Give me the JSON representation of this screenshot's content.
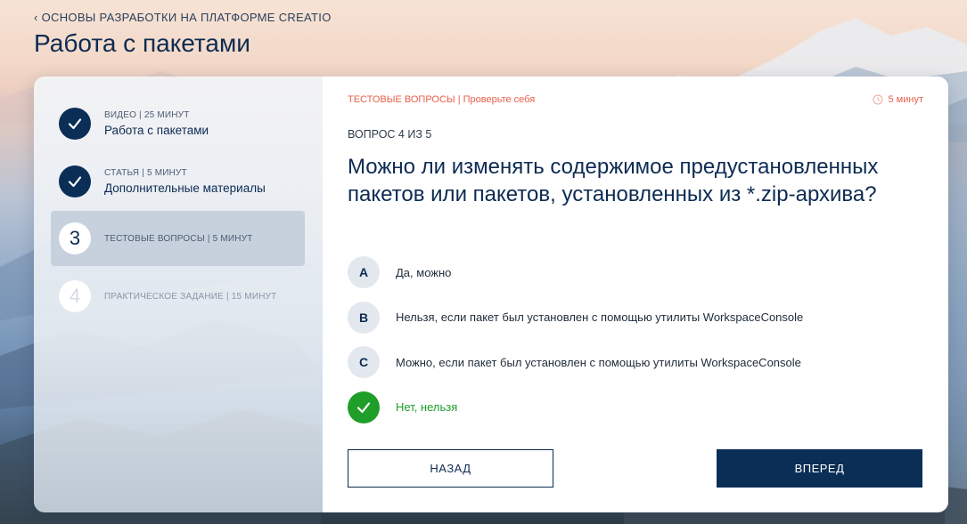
{
  "header": {
    "breadcrumb": "ОСНОВЫ РАЗРАБОТКИ НА ПЛАТФОРМЕ CREATIO",
    "title": "Работа с пакетами"
  },
  "sidebar": {
    "steps": [
      {
        "status": "done",
        "meta": "ВИДЕО | 25 МИНУТ",
        "name": "Работа с пакетами"
      },
      {
        "status": "done",
        "meta": "СТАТЬЯ | 5 МИНУТ",
        "name": "Дополнительные материалы"
      },
      {
        "status": "current",
        "number": "3",
        "meta": "ТЕСТОВЫЕ ВОПРОСЫ | 5 МИНУТ"
      },
      {
        "status": "todo",
        "number": "4",
        "meta": "ПРАКТИЧЕСКОЕ ЗАДАНИЕ | 15 МИНУТ"
      }
    ]
  },
  "main": {
    "section_label": "ТЕСТОВЫЕ ВОПРОСЫ",
    "section_sub": " | Проверьте себя",
    "timer": "5 минут",
    "question_count": "ВОПРОС 4 ИЗ 5",
    "question": "Можно ли изменять содержимое предустановленных пакетов или пакетов, установленных из *.zip-архива?",
    "options": [
      {
        "letter": "A",
        "text": "Да, можно"
      },
      {
        "letter": "B",
        "text": "Нельзя, если пакет был установлен с помощью утилиты WorkspaceConsole"
      },
      {
        "letter": "C",
        "text": "Можно, если пакет был установлен с помощью утилиты WorkspaceConsole"
      },
      {
        "letter": "",
        "text": "Нет, нельзя",
        "correct": true
      }
    ],
    "back_label": "НАЗАД",
    "next_label": "ВПЕРЕД"
  },
  "colors": {
    "accent": "#0b2e56",
    "correct": "#1f9e2a",
    "label": "#e8604c"
  },
  "icons": [
    "chevron-left-icon",
    "checkmark-icon",
    "clock-icon"
  ]
}
